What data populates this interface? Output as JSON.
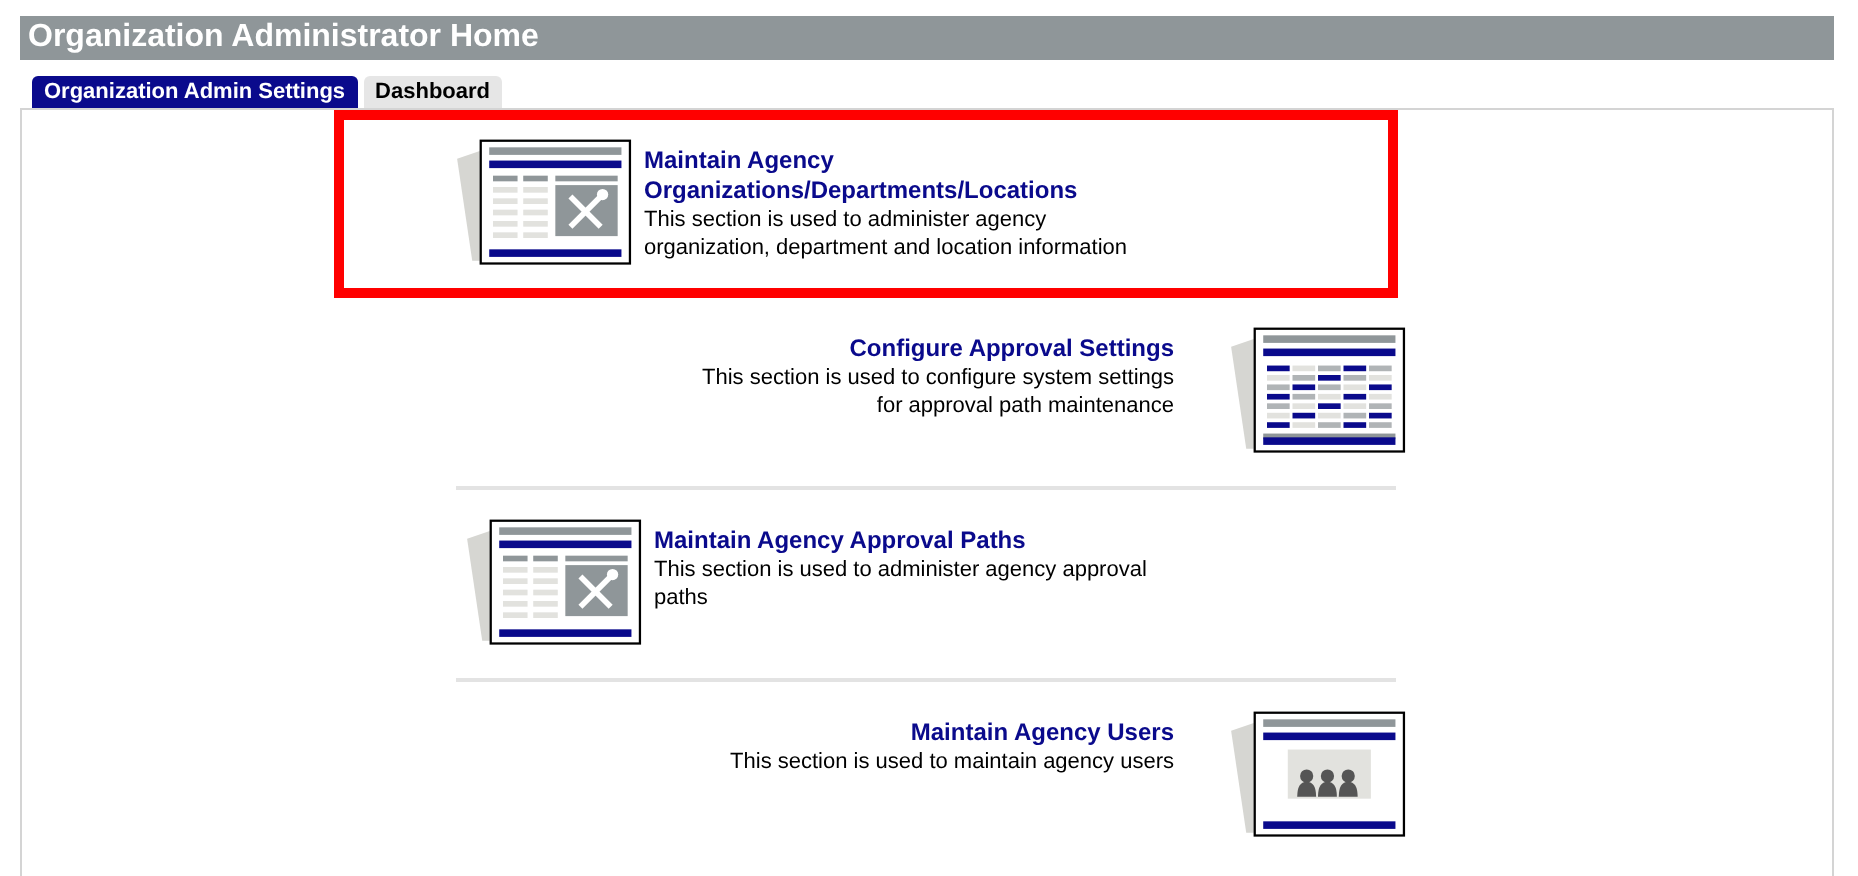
{
  "header": {
    "title": "Organization Administrator Home"
  },
  "tabs": [
    {
      "label": "Organization Admin Settings",
      "selected": true
    },
    {
      "label": "Dashboard",
      "selected": false
    }
  ],
  "sections": [
    {
      "title": "Maintain Agency Organizations/Departments/Locations",
      "description": "This section is used to administer agency organization, department and location information",
      "kind": "tools",
      "highlighted": true
    },
    {
      "title": "Configure Approval Settings",
      "description": "This section is used to configure system settings for approval path maintenance",
      "kind": "grid",
      "highlighted": false
    },
    {
      "title": "Maintain Agency Approval Paths",
      "description": "This section is used to administer agency approval paths",
      "kind": "tools",
      "highlighted": false
    },
    {
      "title": "Maintain Agency Users",
      "description": "This section is used to maintain agency users",
      "kind": "users",
      "highlighted": false
    }
  ]
}
